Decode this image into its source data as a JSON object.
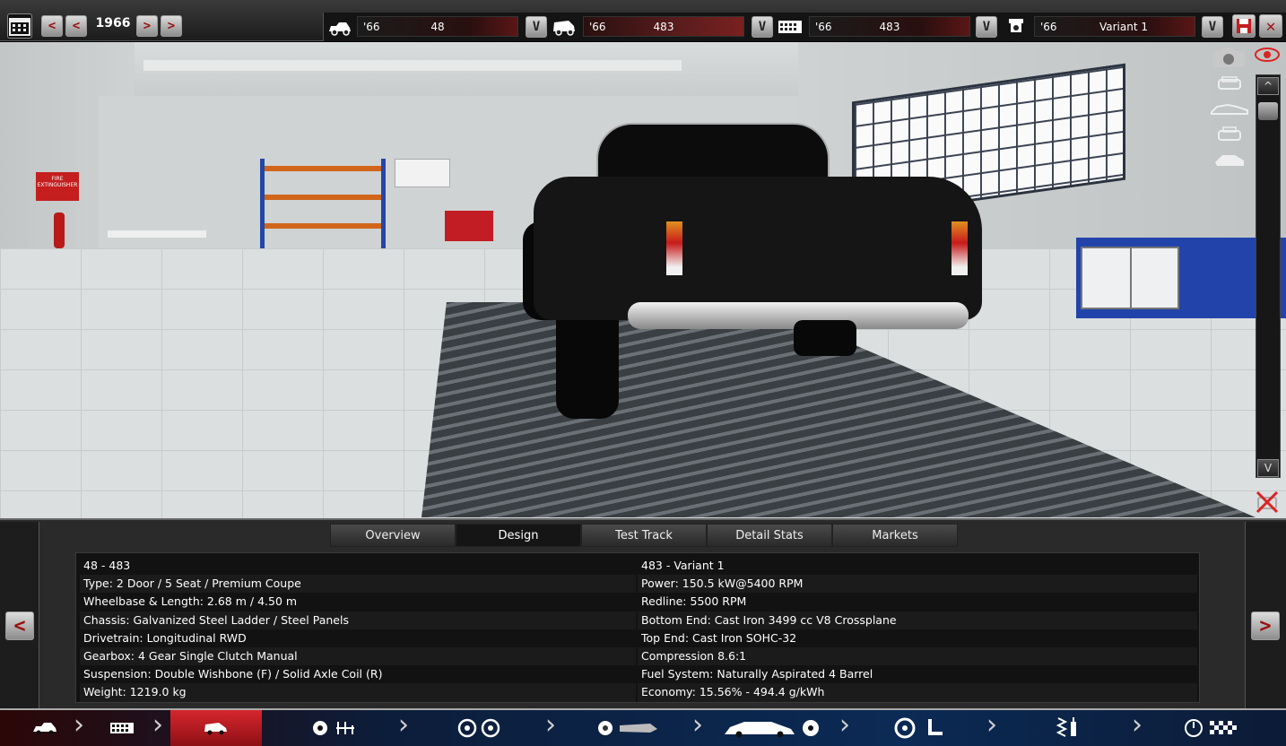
{
  "topbar": {
    "year": "1966",
    "prev_fast": "<",
    "prev": "<",
    "next": ">",
    "next_fast": ">",
    "dropdown_label": "V",
    "fields": [
      {
        "year": "'66",
        "value": "48",
        "icon": "car-model-icon"
      },
      {
        "year": "'66",
        "value": "483",
        "icon": "trim-model-icon"
      },
      {
        "year": "'66",
        "value": "483",
        "icon": "engine-model-icon"
      },
      {
        "year": "'66",
        "value": "Variant 1",
        "icon": "engine-variant-icon"
      }
    ]
  },
  "tabs": [
    "Overview",
    "Design",
    "Test Track",
    "Detail Stats",
    "Markets"
  ],
  "active_tab": "Design",
  "nav": {
    "left": "<",
    "right": ">"
  },
  "viewport": {
    "scroll_up": "^",
    "scroll_down": "V",
    "sign_text": "FIRE EXTINGUISHER"
  },
  "info": {
    "left": [
      "48 - 483",
      "Type: 2 Door / 5 Seat / Premium Coupe",
      "Wheelbase & Length: 2.68 m / 4.50 m",
      "Chassis: Galvanized Steel Ladder / Steel Panels",
      "Drivetrain: Longitudinal RWD",
      "Gearbox: 4 Gear Single Clutch Manual",
      "Suspension: Double Wishbone (F) / Solid Axle Coil (R)",
      "Weight: 1219.0 kg"
    ],
    "right": [
      "483 - Variant 1",
      "Power: 150.5 kW@5400 RPM",
      "Redline: 5500 RPM",
      "Bottom End: Cast Iron 3499 cc V8 Crossplane",
      "Top End: Cast Iron SOHC-32",
      "Compression 8.6:1",
      "Fuel System: Naturally Aspirated 4 Barrel",
      "Economy: 15.56% - 494.4 g/kWh"
    ]
  },
  "bottom_nav": [
    {
      "name": "car-model-icon",
      "active": false
    },
    {
      "name": "chassis-icon",
      "active": false
    },
    {
      "name": "trim-icon",
      "active": true
    },
    {
      "name": "engine-gearbox-icon",
      "active": false
    },
    {
      "name": "wheels-icon",
      "active": false
    },
    {
      "name": "fixtures-icon",
      "active": false
    },
    {
      "name": "body-cooling-icon",
      "active": false
    },
    {
      "name": "interior-icon",
      "active": false
    },
    {
      "name": "suspension-icon",
      "active": false
    },
    {
      "name": "test-track-icon",
      "active": false
    }
  ],
  "colors": {
    "accent": "#c41e1e",
    "bottom_active": "#d6262d",
    "panel": "#2a2a2a"
  }
}
